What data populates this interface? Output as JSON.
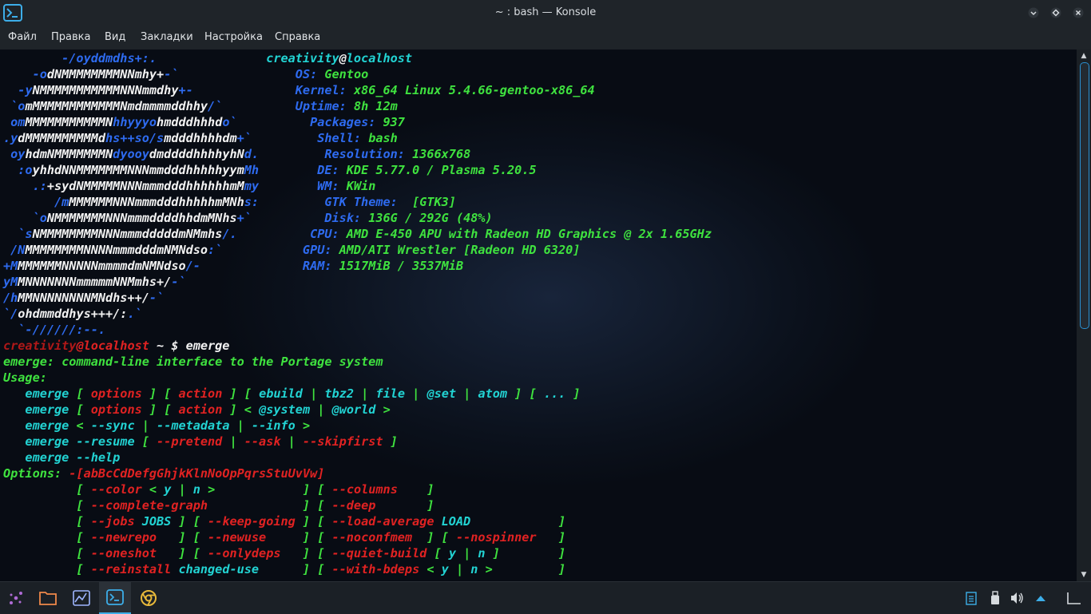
{
  "window": {
    "title": "~ : bash — Konsole"
  },
  "menu": [
    "Файл",
    "Правка",
    "Вид",
    "Закладки",
    "Настройка",
    "Справка"
  ],
  "terminal_lines": [
    [
      [
        "        -/oyddmdhs+:.               ",
        "b"
      ],
      [
        "creativity",
        "cy"
      ],
      [
        "@",
        "w"
      ],
      [
        "localhost",
        "cy"
      ]
    ],
    [
      [
        "    -",
        "b"
      ],
      [
        "o",
        "b"
      ],
      [
        "dNMMMMMMMMNNmhy+",
        "w"
      ],
      [
        "-`",
        "b"
      ],
      [
        "                ",
        "b"
      ],
      [
        "OS: ",
        "b"
      ],
      [
        "Gentoo",
        "g"
      ]
    ],
    [
      [
        "  -",
        "b"
      ],
      [
        "y",
        "b"
      ],
      [
        "NMMMMMMMMMMMNNNmmdhy",
        "w"
      ],
      [
        "+-",
        "b"
      ],
      [
        "              ",
        "b"
      ],
      [
        "Kernel: ",
        "b"
      ],
      [
        "x86_64 Linux 5.4.66-gentoo-x86_64",
        "g"
      ]
    ],
    [
      [
        " `",
        "b"
      ],
      [
        "o",
        "b"
      ],
      [
        "mMMMMMMMMMMMMNmdmmmmddhhy",
        "w"
      ],
      [
        "/`",
        "b"
      ],
      [
        "          ",
        "b"
      ],
      [
        "Uptime: ",
        "b"
      ],
      [
        "8h 12m",
        "g"
      ]
    ],
    [
      [
        " om",
        "b"
      ],
      [
        "MMMMMMMMMMMN",
        "w"
      ],
      [
        "hhyyyo",
        "b"
      ],
      [
        "hmdddhhhd",
        "w"
      ],
      [
        "o`",
        "b"
      ],
      [
        "          ",
        "b"
      ],
      [
        "Packages: ",
        "b"
      ],
      [
        "937",
        "g"
      ]
    ],
    [
      [
        ".y",
        "b"
      ],
      [
        "dMMMMMMMMMMd",
        "w"
      ],
      [
        "hs++so/s",
        "b"
      ],
      [
        "mdddhhhhdm",
        "w"
      ],
      [
        "+`",
        "b"
      ],
      [
        "         ",
        "b"
      ],
      [
        "Shell: ",
        "b"
      ],
      [
        "bash",
        "g"
      ]
    ],
    [
      [
        " oy",
        "b"
      ],
      [
        "hdmNMMMMMMMN",
        "w"
      ],
      [
        "dyooy",
        "b"
      ],
      [
        "dmddddhhhhyhN",
        "w"
      ],
      [
        "d.",
        "b"
      ],
      [
        "         ",
        "b"
      ],
      [
        "Resolution: ",
        "b"
      ],
      [
        "1366x768",
        "g"
      ]
    ],
    [
      [
        "  :o",
        "b"
      ],
      [
        "yhhdNNMMMMMMMNNNmmdddhhhhhyym",
        "w"
      ],
      [
        "Mh",
        "b"
      ],
      [
        "        ",
        "b"
      ],
      [
        "DE: ",
        "b"
      ],
      [
        "KDE 5.77.0 / Plasma 5.20.5",
        "g"
      ]
    ],
    [
      [
        "    .:",
        "b"
      ],
      [
        "+sydNMMMMMNNNmmmdddhhhhhhmM",
        "w"
      ],
      [
        "my",
        "b"
      ],
      [
        "        ",
        "b"
      ],
      [
        "WM: ",
        "b"
      ],
      [
        "KWin",
        "g"
      ]
    ],
    [
      [
        "       /m",
        "b"
      ],
      [
        "MMMMMMNNNmmmdddhhhhhmMNh",
        "w"
      ],
      [
        "s:",
        "b"
      ],
      [
        "         ",
        "b"
      ],
      [
        "GTK Theme: ",
        "b"
      ],
      [
        " [GTK3]",
        "g"
      ]
    ],
    [
      [
        "    `o",
        "b"
      ],
      [
        "NMMMMMMMNNNmmmddddhhdmMNhs",
        "w"
      ],
      [
        "+`",
        "b"
      ],
      [
        "          ",
        "b"
      ],
      [
        "Disk: ",
        "b"
      ],
      [
        "136G / 292G (48%)",
        "g"
      ]
    ],
    [
      [
        "  `s",
        "b"
      ],
      [
        "NMMMMMMMMNNNmmmdddddmNMmhs",
        "w"
      ],
      [
        "/.",
        "b"
      ],
      [
        "          ",
        "b"
      ],
      [
        "CPU: ",
        "b"
      ],
      [
        "AMD E-450 APU with Radeon HD Graphics @ 2x 1.65GHz",
        "g"
      ]
    ],
    [
      [
        " /N",
        "b"
      ],
      [
        "MMMMMMMMNNNNmmmdddmNMNdso",
        "w"
      ],
      [
        ":`",
        "b"
      ],
      [
        "           ",
        "b"
      ],
      [
        "GPU: ",
        "b"
      ],
      [
        "AMD/ATI Wrestler [Radeon HD 6320]",
        "g"
      ]
    ],
    [
      [
        "+M",
        "b"
      ],
      [
        "MMMMMMNNNNNmmmmdmNMNdso",
        "w"
      ],
      [
        "/-",
        "b"
      ],
      [
        "              ",
        "b"
      ],
      [
        "RAM: ",
        "b"
      ],
      [
        "1517MiB / 3537MiB",
        "g"
      ]
    ],
    [
      [
        "yM",
        "b"
      ],
      [
        "MNNNNNNNmmmmmNNMmhs+/",
        "w"
      ],
      [
        "-`",
        "b"
      ]
    ],
    [
      [
        "/h",
        "b"
      ],
      [
        "MMNNNNNNNNMNdhs++/",
        "w"
      ],
      [
        "-`",
        "b"
      ]
    ],
    [
      [
        "`/",
        "b"
      ],
      [
        "ohdmmddhys+++/:",
        "w"
      ],
      [
        ".`",
        "b"
      ]
    ],
    [
      [
        "  `-//////:--.",
        "b"
      ]
    ],
    [
      [
        "creativity",
        "dr"
      ],
      [
        "@localhost",
        "r"
      ],
      [
        " ~ $ ",
        "w"
      ],
      [
        "emerge",
        "w"
      ]
    ],
    [
      [
        "emerge: command-line interface to the Portage system",
        "g"
      ]
    ],
    [
      [
        "Usage:",
        "g"
      ]
    ],
    [
      [
        "   emerge ",
        "cy"
      ],
      [
        "[ ",
        "g"
      ],
      [
        "options",
        "r"
      ],
      [
        " ] ",
        "g"
      ],
      [
        "[ ",
        "g"
      ],
      [
        "action",
        "r"
      ],
      [
        " ] ",
        "g"
      ],
      [
        "[ ",
        "g"
      ],
      [
        "ebuild",
        "cy"
      ],
      [
        " | ",
        "g"
      ],
      [
        "tbz2",
        "cy"
      ],
      [
        " | ",
        "g"
      ],
      [
        "file",
        "cy"
      ],
      [
        " | ",
        "g"
      ],
      [
        "@set",
        "cy"
      ],
      [
        " | ",
        "g"
      ],
      [
        "atom",
        "cy"
      ],
      [
        " ] [ ",
        "g"
      ],
      [
        "...",
        "cy"
      ],
      [
        " ]",
        "g"
      ]
    ],
    [
      [
        "   emerge ",
        "cy"
      ],
      [
        "[ ",
        "g"
      ],
      [
        "options",
        "r"
      ],
      [
        " ] ",
        "g"
      ],
      [
        "[ ",
        "g"
      ],
      [
        "action",
        "r"
      ],
      [
        " ] ",
        "g"
      ],
      [
        "< ",
        "g"
      ],
      [
        "@system",
        "cy"
      ],
      [
        " | ",
        "g"
      ],
      [
        "@world",
        "cy"
      ],
      [
        " >",
        "g"
      ]
    ],
    [
      [
        "   emerge ",
        "cy"
      ],
      [
        "< ",
        "g"
      ],
      [
        "--sync",
        "cy"
      ],
      [
        " | ",
        "g"
      ],
      [
        "--metadata",
        "cy"
      ],
      [
        " | ",
        "g"
      ],
      [
        "--info",
        "cy"
      ],
      [
        " >",
        "g"
      ]
    ],
    [
      [
        "   emerge --resume ",
        "cy"
      ],
      [
        "[ ",
        "g"
      ],
      [
        "--pretend",
        "r"
      ],
      [
        " | ",
        "g"
      ],
      [
        "--ask",
        "r"
      ],
      [
        " | ",
        "g"
      ],
      [
        "--skipfirst",
        "r"
      ],
      [
        " ]",
        "g"
      ]
    ],
    [
      [
        "   emerge --help",
        "cy"
      ]
    ],
    [
      [
        "Options: ",
        "g"
      ],
      [
        "-[abBcCdDefgGhjkKlnNoOpPqrsStuUvVw]",
        "r"
      ]
    ],
    [
      [
        "          [ ",
        "g"
      ],
      [
        "--color",
        "r"
      ],
      [
        " < ",
        "g"
      ],
      [
        "y",
        "cy"
      ],
      [
        " | ",
        "g"
      ],
      [
        "n",
        "cy"
      ],
      [
        " >",
        "g"
      ],
      [
        "            ] [ ",
        "g"
      ],
      [
        "--columns",
        "r"
      ],
      [
        "    ]",
        "g"
      ]
    ],
    [
      [
        "          [ ",
        "g"
      ],
      [
        "--complete-graph",
        "r"
      ],
      [
        "             ] [ ",
        "g"
      ],
      [
        "--deep",
        "r"
      ],
      [
        "       ]",
        "g"
      ]
    ],
    [
      [
        "          [ ",
        "g"
      ],
      [
        "--jobs ",
        "r"
      ],
      [
        "JOBS",
        "cy"
      ],
      [
        " ] [ ",
        "g"
      ],
      [
        "--keep-going",
        "r"
      ],
      [
        " ] [ ",
        "g"
      ],
      [
        "--load-average ",
        "r"
      ],
      [
        "LOAD",
        "cy"
      ],
      [
        "            ]",
        "g"
      ]
    ],
    [
      [
        "          [ ",
        "g"
      ],
      [
        "--newrepo",
        "r"
      ],
      [
        "   ] [ ",
        "g"
      ],
      [
        "--newuse",
        "r"
      ],
      [
        "     ] [ ",
        "g"
      ],
      [
        "--noconfmem",
        "r"
      ],
      [
        "  ] [ ",
        "g"
      ],
      [
        "--nospinner",
        "r"
      ],
      [
        "   ]",
        "g"
      ]
    ],
    [
      [
        "          [ ",
        "g"
      ],
      [
        "--oneshot",
        "r"
      ],
      [
        "   ] [ ",
        "g"
      ],
      [
        "--onlydeps",
        "r"
      ],
      [
        "   ] [ ",
        "g"
      ],
      [
        "--quiet-build",
        "r"
      ],
      [
        " [ ",
        "g"
      ],
      [
        "y",
        "cy"
      ],
      [
        " | ",
        "g"
      ],
      [
        "n",
        "cy"
      ],
      [
        " ]",
        "g"
      ],
      [
        "        ]",
        "g"
      ]
    ],
    [
      [
        "          [ ",
        "g"
      ],
      [
        "--reinstall ",
        "r"
      ],
      [
        "changed-use",
        "cy"
      ],
      [
        "      ] [ ",
        "g"
      ],
      [
        "--with-bdeps",
        "r"
      ],
      [
        " < ",
        "g"
      ],
      [
        "y",
        "cy"
      ],
      [
        " | ",
        "g"
      ],
      [
        "n",
        "cy"
      ],
      [
        " >",
        "g"
      ],
      [
        "         ]",
        "g"
      ]
    ]
  ],
  "taskbar": {
    "items": [
      "launcher-icon",
      "folder-icon",
      "system-monitor-icon",
      "konsole-icon",
      "chrome-icon"
    ],
    "tray": [
      "clipboard-icon",
      "usb-icon",
      "volume-icon",
      "arrow-up-icon",
      "desktop-icon"
    ]
  },
  "colors": {
    "accent": "#3daee9",
    "bg": "#1f2429"
  }
}
